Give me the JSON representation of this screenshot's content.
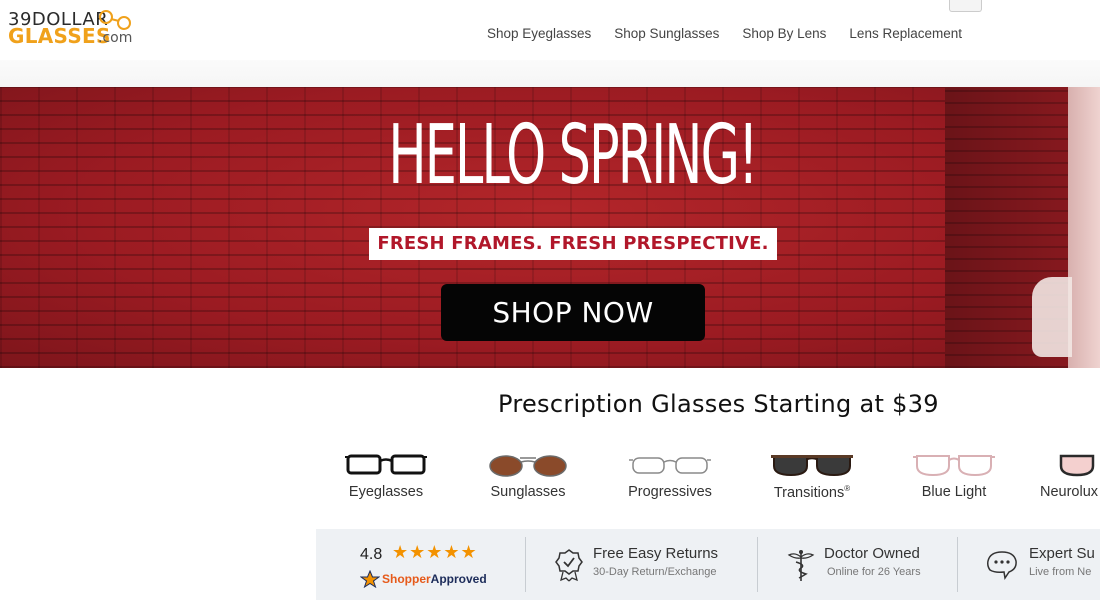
{
  "brand": {
    "line1": "39DOLLAR",
    "line2": "GLASSES",
    "line3": ".com",
    "accent": "#f0a11b"
  },
  "nav": [
    {
      "label": "Shop Eyeglasses"
    },
    {
      "label": "Shop Sunglasses"
    },
    {
      "label": "Shop By Lens"
    },
    {
      "label": "Lens Replacement"
    }
  ],
  "hero": {
    "title": "HELLO SPRING!",
    "subtitle": "FRESH FRAMES. FRESH PRESPECTIVE.",
    "cta": "SHOP NOW",
    "background_color": "#a51d24"
  },
  "section": {
    "title": "Prescription Glasses Starting at $39"
  },
  "categories": [
    {
      "label": "Eyeglasses",
      "icon": "black-frame-glasses-icon"
    },
    {
      "label": "Sunglasses",
      "icon": "brown-aviator-sunglasses-icon"
    },
    {
      "label": "Progressives",
      "icon": "wire-frame-glasses-icon"
    },
    {
      "label": "Transitions",
      "mark": "®",
      "icon": "tinted-tortoise-glasses-icon"
    },
    {
      "label": "Blue Light",
      "icon": "pink-clear-frame-glasses-icon"
    },
    {
      "label": "Neurolux",
      "icon": "pink-tint-glasses-icon"
    }
  ],
  "trust": {
    "rating": "4.8",
    "stars": "★★★★★",
    "rating_out_of": 5,
    "shopper_approved": {
      "part1": "Shopper",
      "part2": "Approved"
    },
    "features": [
      {
        "title": "Free Easy Returns",
        "subtitle": "30-Day Return/Exchange",
        "icon": "badge-check-icon"
      },
      {
        "title": "Doctor Owned",
        "subtitle": "Online for 26 Years",
        "icon": "caduceus-icon"
      },
      {
        "title": "Expert Su",
        "subtitle": "Live from Ne",
        "icon": "support-chat-icon"
      }
    ]
  }
}
